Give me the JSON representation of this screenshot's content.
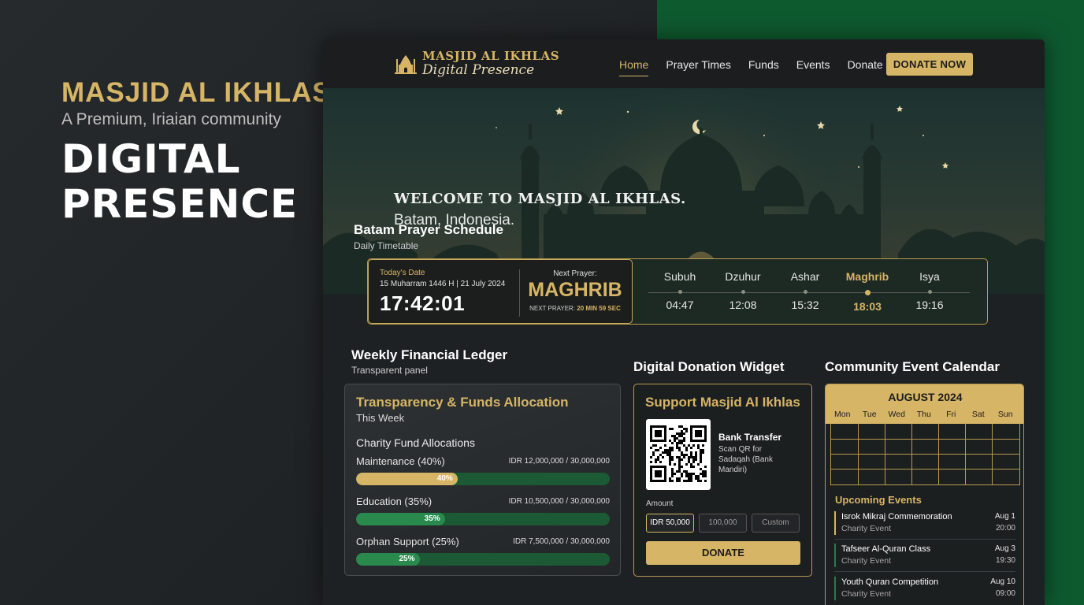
{
  "hero_left": {
    "brand": "MASJID AL IKHLAS",
    "tagline": "A Premium, Iriaian community",
    "headline_1": "DIGITAL",
    "headline_2": "PRESENCE"
  },
  "nav": {
    "logo_line1": "MASJID AL IKHLAS",
    "logo_line2": "Digital Presence",
    "links": [
      "Home",
      "Prayer Times",
      "Funds",
      "Events",
      "Donate"
    ],
    "active": "Home",
    "cta": "DONATE NOW"
  },
  "hero": {
    "welcome": "WELCOME TO MASJID AL IKHLAS.",
    "location": "Batam, Indonesia.",
    "schedule_title": "Batam Prayer Schedule",
    "schedule_sub": "Daily Timetable"
  },
  "prayer": {
    "today_label": "Today's Date",
    "today_value": "15 Muharram 1446 H | 21 July 2024",
    "clock": "17:42:01",
    "next_label": "Next Prayer:",
    "next_value": "MAGHRIB",
    "countdown_label": "NEXT PRAYER:",
    "countdown_value": "20 MIN 59 SEC",
    "times": [
      {
        "name": "Subuh",
        "time": "04:47"
      },
      {
        "name": "Dzuhur",
        "time": "12:08"
      },
      {
        "name": "Ashar",
        "time": "15:32"
      },
      {
        "name": "Maghrib",
        "time": "18:03"
      },
      {
        "name": "Isya",
        "time": "19:16"
      }
    ],
    "active_index": 3
  },
  "ledger": {
    "section_title": "Weekly Financial Ledger",
    "section_sub": "Transparent panel",
    "title": "Transparency & Funds Allocation",
    "period": "This Week",
    "allocations_title": "Charity Fund Allocations",
    "funds": [
      {
        "name": "Maintenance (40%)",
        "amount": "IDR 12,000,000 / 30,000,000",
        "percent": 40,
        "label": "40%",
        "color": "#d6b566"
      },
      {
        "name": "Education (35%)",
        "amount": "IDR 10,500,000 / 30,000,000",
        "percent": 35,
        "label": "35%",
        "color": "#2a8a4e"
      },
      {
        "name": "Orphan Support (25%)",
        "amount": "IDR 7,500,000 / 30,000,000",
        "percent": 25,
        "label": "25%",
        "color": "#2a8a4e"
      }
    ]
  },
  "donation": {
    "section_title": "Digital Donation Widget",
    "title": "Support Masjid Al Ikhlas",
    "bank_title": "Bank Transfer",
    "bank_sub": "Scan QR for Sadaqah (Bank Mandiri)",
    "amount_label": "Amount",
    "amounts": [
      "IDR 50,000",
      "100,000",
      "Custom"
    ],
    "selected_amount": "IDR 50,000",
    "button": "DONATE"
  },
  "calendar": {
    "section_title": "Community Event Calendar",
    "month": "AUGUST 2024",
    "days": [
      "Mon",
      "Tue",
      "Wed",
      "Thu",
      "Fri",
      "Sat",
      "Sun"
    ],
    "upcoming_title": "Upcoming Events",
    "events": [
      {
        "name": "Isrok Mikraj Commemoration",
        "category": "Charity Event",
        "date": "Aug 1",
        "time": "20:00"
      },
      {
        "name": "Tafseer Al-Quran Class",
        "category": "Charity Event",
        "date": "Aug 3",
        "time": "19:30"
      },
      {
        "name": "Youth Quran Competition",
        "category": "Charity Event",
        "date": "Aug 10",
        "time": "09:00"
      }
    ]
  },
  "colors": {
    "gold": "#d6b566",
    "green": "#0e5a2f",
    "dark": "#1d2022"
  }
}
